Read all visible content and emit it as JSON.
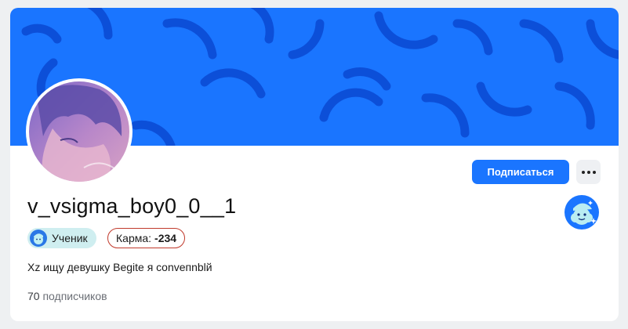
{
  "profile": {
    "username": "v_vsigma_boy0_0__1",
    "role_label": "Ученик",
    "karma_label": "Карма:",
    "karma_value": "-234",
    "bio": "Xz ищу девушку Begite я conveпnblй",
    "followers_count": "70",
    "followers_label": "подписчиков"
  },
  "actions": {
    "subscribe_label": "Подписаться",
    "more_icon": "more-dots-icon"
  },
  "icons": {
    "role": "student-icon",
    "badge": "mascot-badge-icon"
  },
  "colors": {
    "banner": "#1a75ff",
    "banner_arcs": "#0c4fd8",
    "accent": "#1a75ff",
    "role_pill_bg": "#cfeef0",
    "karma_border": "#c0392b"
  }
}
